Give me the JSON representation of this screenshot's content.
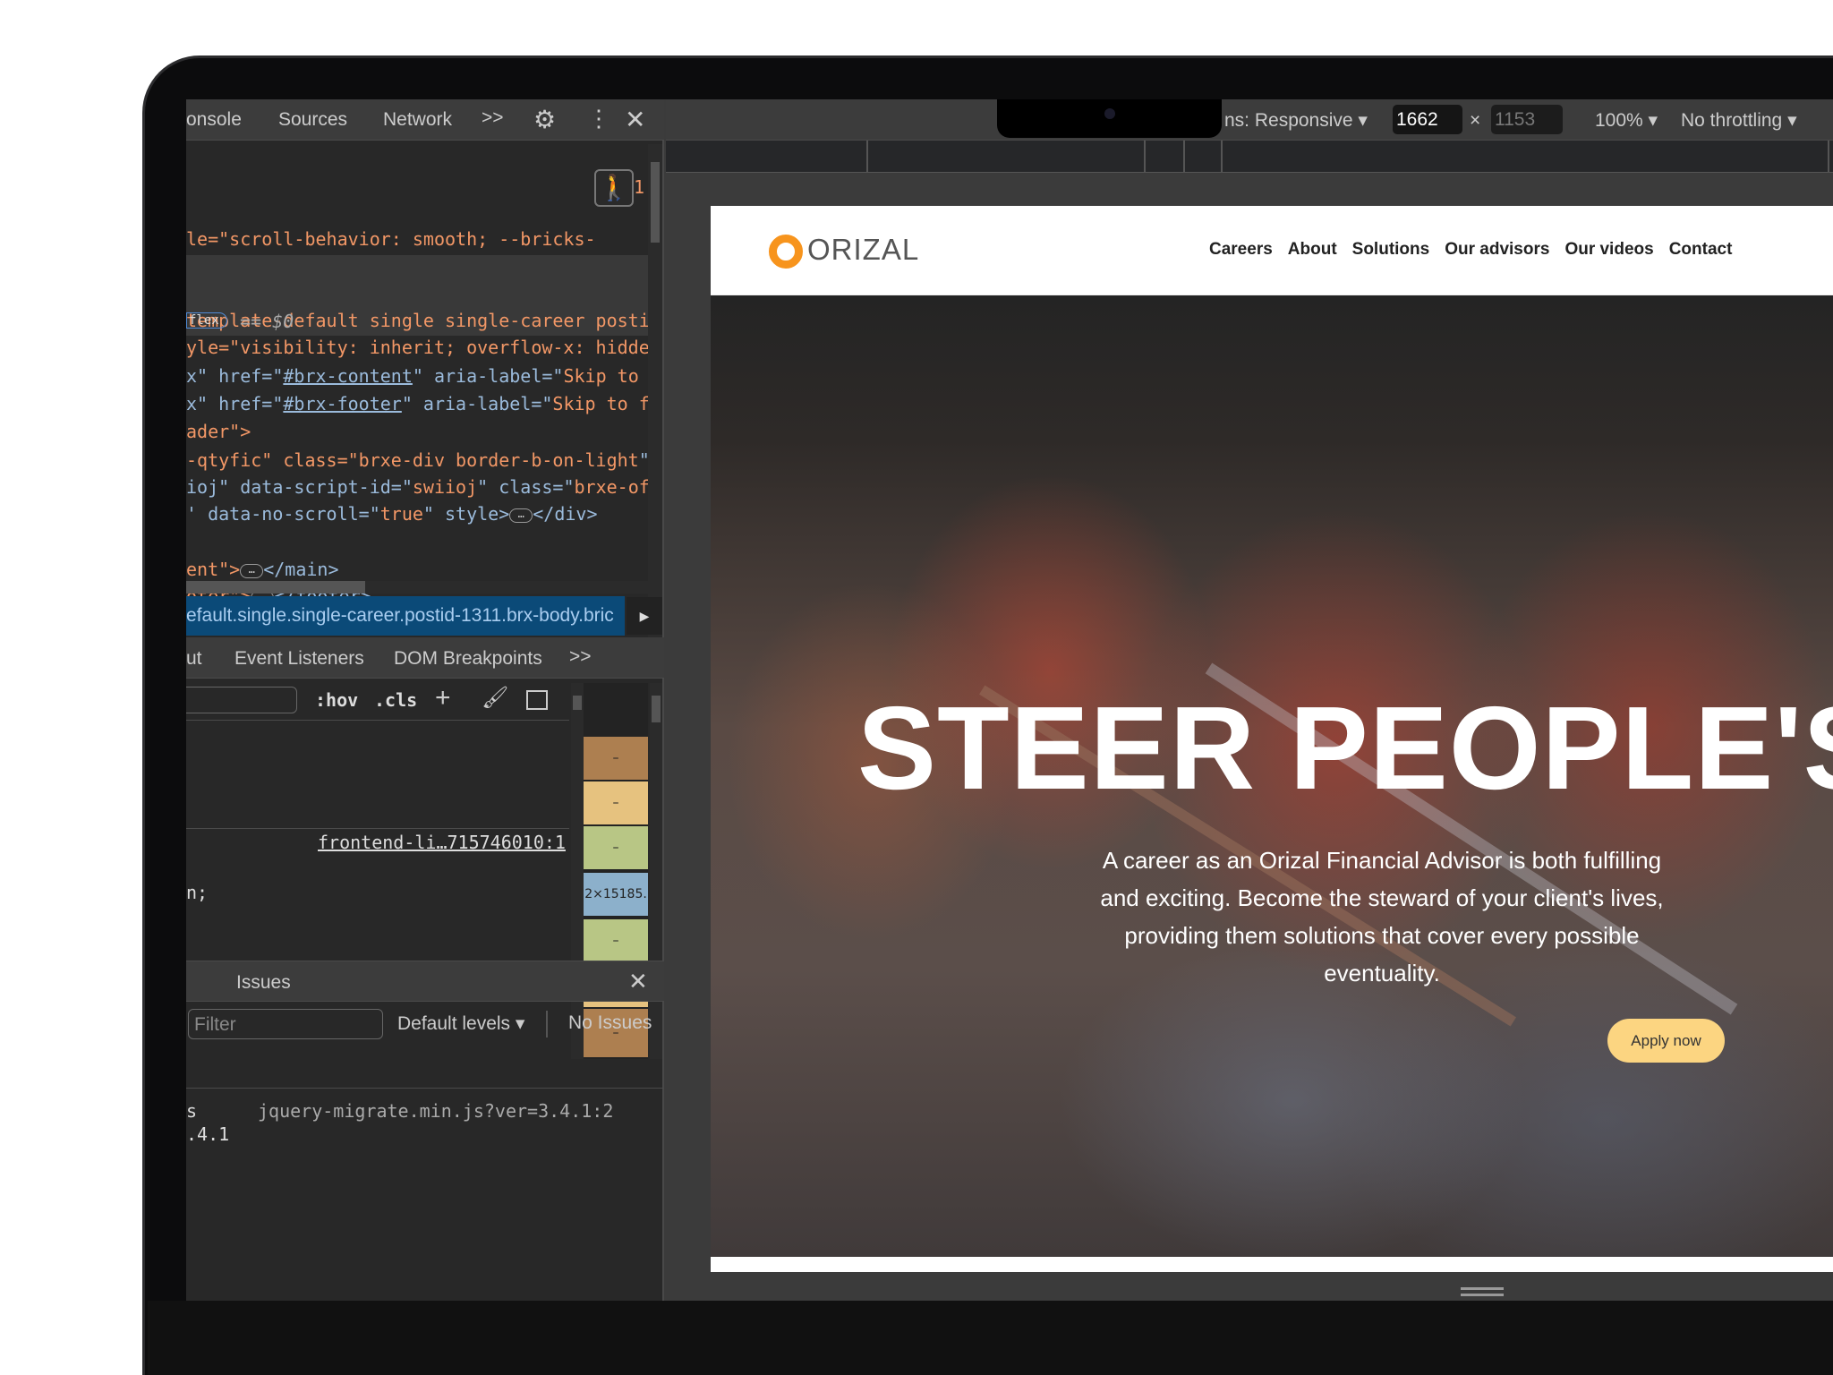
{
  "devtools": {
    "tabs": [
      "onsole",
      "Sources",
      "Network"
    ],
    "more": ">>",
    "code_lines": [
      [
        {
          "t": "le=\"scroll-behavior: smooth; --bricks-",
          "c": "o"
        }
      ],
      [
        {
          "t": "template-default single single-career postic",
          "c": "o"
        }
      ],
      [
        {
          "t": "yle=\"visibility: inherit; overflow-x: hidder",
          "c": "o"
        }
      ],
      [
        {
          "t": "x\" href=\"",
          "c": "b"
        },
        {
          "t": "#brx-content",
          "c": "b u"
        },
        {
          "t": "\" aria-label=\"",
          "c": "b"
        },
        {
          "t": "Skip to m",
          "c": "o"
        }
      ],
      [
        {
          "t": "x\" href=\"",
          "c": "b"
        },
        {
          "t": "#brx-footer",
          "c": "b u"
        },
        {
          "t": "\" aria-label=\"",
          "c": "b"
        },
        {
          "t": "Skip to fo",
          "c": "o"
        }
      ],
      [
        {
          "t": "ader\">",
          "c": "o"
        }
      ],
      [
        {
          "t": "-qtyfic\" class=\"",
          "c": "o"
        },
        {
          "t": "brxe-div border-b-on-light",
          "c": "o"
        },
        {
          "t": "\">",
          "c": "b"
        }
      ],
      [
        {
          "t": "ioj\" data-script-id=\"",
          "c": "b"
        },
        {
          "t": "swiioj",
          "c": "o"
        },
        {
          "t": "\" class=\"",
          "c": "b"
        },
        {
          "t": "brxe-of",
          "c": "o"
        }
      ],
      [
        {
          "t": "' data-no-scroll=\"",
          "c": "b"
        },
        {
          "t": "true",
          "c": "o"
        },
        {
          "t": "\" style>",
          "c": "b"
        },
        {
          "t": "…",
          "c": "ell"
        },
        {
          "t": "</div>",
          "c": "b"
        }
      ],
      [
        {
          "t": "ent\">",
          "c": "o"
        },
        {
          "t": "…",
          "c": "ell"
        },
        {
          "t": "</main>",
          "c": "b"
        }
      ],
      [
        {
          "t": "oter\">",
          "c": "o"
        },
        {
          "t": "…",
          "c": "ell"
        },
        {
          "t": "</footer>",
          "c": "b"
        }
      ]
    ],
    "badge": "flex",
    "dollar": "== $0",
    "line_end": "1",
    "breadcrumb": "efault.single.single-career.postid-1311.brx-body.bric",
    "panel_tabs": [
      "ut",
      "Event Listeners",
      "DOM Breakpoints"
    ],
    "hov": ":hov",
    "cls": ".cls",
    "source_link": "frontend-li…715746010:1",
    "rule_tail": "n;",
    "box_model_size": "2×15185.",
    "box_dash": "–",
    "drawer_tab": "Issues",
    "filter_placeholder": "Filter",
    "levels": "Default levels",
    "no_issues": "No Issues",
    "console_line1": "s",
    "console_source": "jquery-migrate.min.js?ver=3.4.1:2",
    "console_line2": ".4.1"
  },
  "device_toolbar": {
    "dimensions": "ns: Responsive",
    "width": "1662",
    "x": "×",
    "height": "1153",
    "zoom": "100%",
    "throttling": "No throttling"
  },
  "page": {
    "logo": "ORIZAL",
    "brand_color": "#f7941d",
    "nav": [
      "Careers",
      "About",
      "Solutions",
      "Our advisors",
      "Our videos",
      "Contact"
    ],
    "headline": "STEER PEOPLE'S LI",
    "paragraph_lines": [
      "A career as an Orizal Financial Advisor is both fulfilling",
      "and exciting. Become the steward of your client's lives,",
      "providing them solutions that cover every possible",
      "eventuality."
    ],
    "cta": "Apply now",
    "cta_color": "#fcd581"
  }
}
